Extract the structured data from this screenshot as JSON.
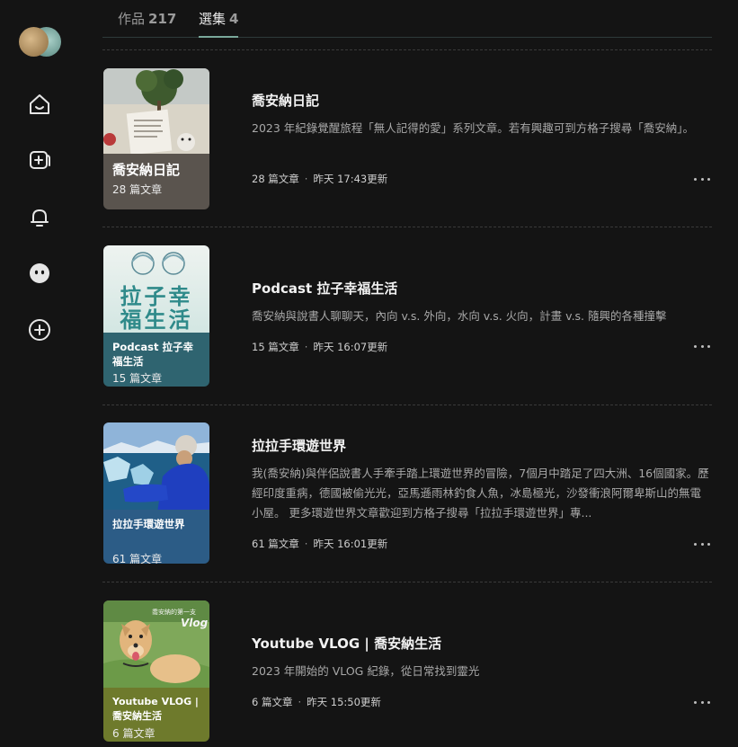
{
  "tabs": [
    {
      "label": "作品",
      "count": "217"
    },
    {
      "label": "選集",
      "count": "4"
    }
  ],
  "sidebar": {
    "icons": [
      "home-icon",
      "compose-icon",
      "bell-icon",
      "face-icon",
      "add-circle-icon"
    ]
  },
  "collections": [
    {
      "title": "喬安納日記",
      "description": "2023 年紀錄覺醒旅程「無人記得的愛」系列文章。若有興趣可到方格子搜尋「喬安納」。",
      "cover_title": "喬安納日記",
      "cover_count": "28 篇文章",
      "articles": "28 篇文章",
      "updated": "昨天 17:43更新",
      "band_color": "#5a544e"
    },
    {
      "title": "Podcast 拉子幸福生活",
      "description": "喬安納與說書人聊聊天，內向 v.s. 外向，水向 v.s. 火向，計畫 v.s. 隨興的各種撞擊",
      "cover_title": "Podcast 拉子幸福生活",
      "cover_count": "15 篇文章",
      "cover_art_text": "拉子幸福生活",
      "articles": "15 篇文章",
      "updated": "昨天 16:07更新",
      "band_color": "#2f6470"
    },
    {
      "title": "拉拉手環遊世界",
      "description": "我(喬安納)與伴侶說書人手牽手踏上環遊世界的冒險，7個月中踏足了四大洲、16個國家。歷經印度重病，德國被偷光光，亞馬遜雨林釣食人魚，冰島極光，沙發衝浪阿爾卑斯山的無電小屋。 更多環遊世界文章歡迎到方格子搜尋「拉拉手環遊世界」專...",
      "cover_title": "拉拉手環遊世界",
      "cover_count": "61 篇文章",
      "articles": "61 篇文章",
      "updated": "昨天 16:01更新",
      "band_color": "#2c5c86"
    },
    {
      "title": "Youtube VLOG | 喬安納生活",
      "description": "2023 年開始的 VLOG 紀錄，從日常找到靈光",
      "cover_title": "Youtube VLOG | 喬安納生活",
      "cover_count": "6 篇文章",
      "cover_art_text": "喬安納的第一支",
      "cover_art_vlog": "Vlog",
      "articles": "6 篇文章",
      "updated": "昨天 15:50更新",
      "band_color": "#6e7a2c"
    }
  ]
}
